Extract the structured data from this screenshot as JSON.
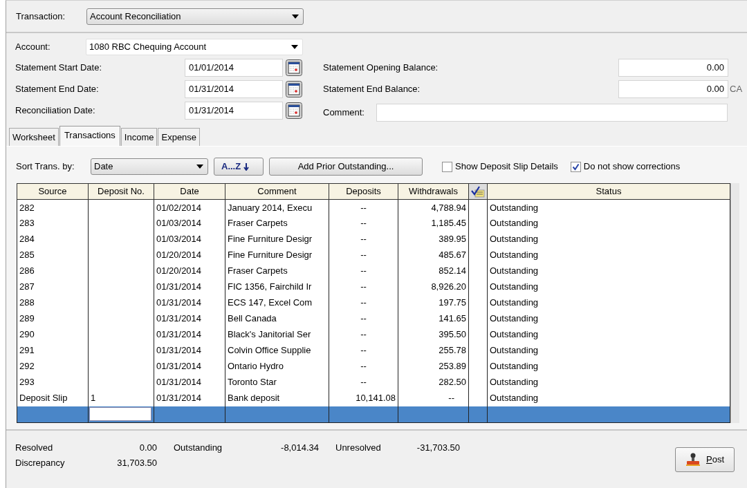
{
  "transaction": {
    "label": "Transaction:",
    "value": "Account Reconciliation"
  },
  "account": {
    "label": "Account:",
    "value": "1080 RBC Chequing Account"
  },
  "dates": [
    {
      "label": "Statement Start Date:",
      "value": "01/01/2014"
    },
    {
      "label": "Statement End Date:",
      "value": "01/31/2014"
    },
    {
      "label": "Reconciliation Date:",
      "value": "01/31/2014"
    }
  ],
  "balances": [
    {
      "label": "Statement Opening Balance:",
      "value": "0.00"
    },
    {
      "label": "Statement End Balance:",
      "value": "0.00",
      "currency": "CA"
    }
  ],
  "comment": {
    "label": "Comment:"
  },
  "tabs": [
    {
      "label": "Worksheet",
      "selected": false
    },
    {
      "label": "Transactions",
      "selected": true
    },
    {
      "label": "Income",
      "selected": false
    },
    {
      "label": "Expense",
      "selected": false
    }
  ],
  "sort": {
    "label": "Sort Trans. by:",
    "value": "Date",
    "order_button": "A...Z"
  },
  "add_button": "Add Prior Outstanding...",
  "options": [
    {
      "label": "Show Deposit Slip Details",
      "checked": false
    },
    {
      "label": "Do not show corrections",
      "checked": true
    }
  ],
  "table": {
    "columns": [
      "Source",
      "Deposit No.",
      "Date",
      "Comment",
      "Deposits",
      "Withdrawals",
      "",
      "Status"
    ],
    "rows": [
      {
        "kind": "transaction",
        "selected": false,
        "cells": [
          "282",
          "",
          "01/02/2014",
          "January 2014, Execu",
          "--",
          "4,788.94",
          "",
          "Outstanding"
        ]
      },
      {
        "kind": "transaction",
        "selected": false,
        "cells": [
          "283",
          "",
          "01/03/2014",
          "Fraser Carpets",
          "--",
          "1,185.45",
          "",
          "Outstanding"
        ]
      },
      {
        "kind": "transaction",
        "selected": false,
        "cells": [
          "284",
          "",
          "01/03/2014",
          "Fine Furniture Desigr",
          "--",
          "389.95",
          "",
          "Outstanding"
        ]
      },
      {
        "kind": "transaction",
        "selected": false,
        "cells": [
          "285",
          "",
          "01/20/2014",
          "Fine Furniture Desigr",
          "--",
          "485.67",
          "",
          "Outstanding"
        ]
      },
      {
        "kind": "transaction",
        "selected": false,
        "cells": [
          "286",
          "",
          "01/20/2014",
          "Fraser Carpets",
          "--",
          "852.14",
          "",
          "Outstanding"
        ]
      },
      {
        "kind": "transaction",
        "selected": false,
        "cells": [
          "287",
          "",
          "01/31/2014",
          "FIC 1356, Fairchild Ir",
          "--",
          "8,926.20",
          "",
          "Outstanding"
        ]
      },
      {
        "kind": "transaction",
        "selected": false,
        "cells": [
          "288",
          "",
          "01/31/2014",
          "ECS 147, Excel Com",
          "--",
          "197.75",
          "",
          "Outstanding"
        ]
      },
      {
        "kind": "transaction",
        "selected": false,
        "cells": [
          "289",
          "",
          "01/31/2014",
          "Bell Canada",
          "--",
          "141.65",
          "",
          "Outstanding"
        ]
      },
      {
        "kind": "transaction",
        "selected": false,
        "cells": [
          "290",
          "",
          "01/31/2014",
          "Black's Janitorial Ser",
          "--",
          "395.50",
          "",
          "Outstanding"
        ]
      },
      {
        "kind": "transaction",
        "selected": false,
        "cells": [
          "291",
          "",
          "01/31/2014",
          "Colvin Office Supplie",
          "--",
          "255.78",
          "",
          "Outstanding"
        ]
      },
      {
        "kind": "transaction",
        "selected": false,
        "cells": [
          "292",
          "",
          "01/31/2014",
          "Ontario Hydro",
          "--",
          "253.89",
          "",
          "Outstanding"
        ]
      },
      {
        "kind": "transaction",
        "selected": false,
        "cells": [
          "293",
          "",
          "01/31/2014",
          "Toronto Star",
          "--",
          "282.50",
          "",
          "Outstanding"
        ]
      },
      {
        "kind": "transaction",
        "selected": false,
        "cells": [
          "Deposit Slip",
          "1",
          "01/31/2014",
          "Bank deposit",
          "10,141.08",
          "--",
          "",
          "Outstanding"
        ]
      },
      {
        "kind": "entry",
        "selected": true,
        "cells": [
          "",
          "",
          "",
          "",
          "",
          "",
          "",
          ""
        ]
      }
    ]
  },
  "summary": [
    [
      {
        "label": "Resolved",
        "value": "0.00"
      },
      {
        "label": "Outstanding",
        "value": "-8,014.34"
      },
      {
        "label": "Unresolved",
        "value": "-31,703.50"
      }
    ],
    [
      {
        "label": "Discrepancy",
        "value": "31,703.50"
      }
    ]
  ],
  "post_button": "Post"
}
